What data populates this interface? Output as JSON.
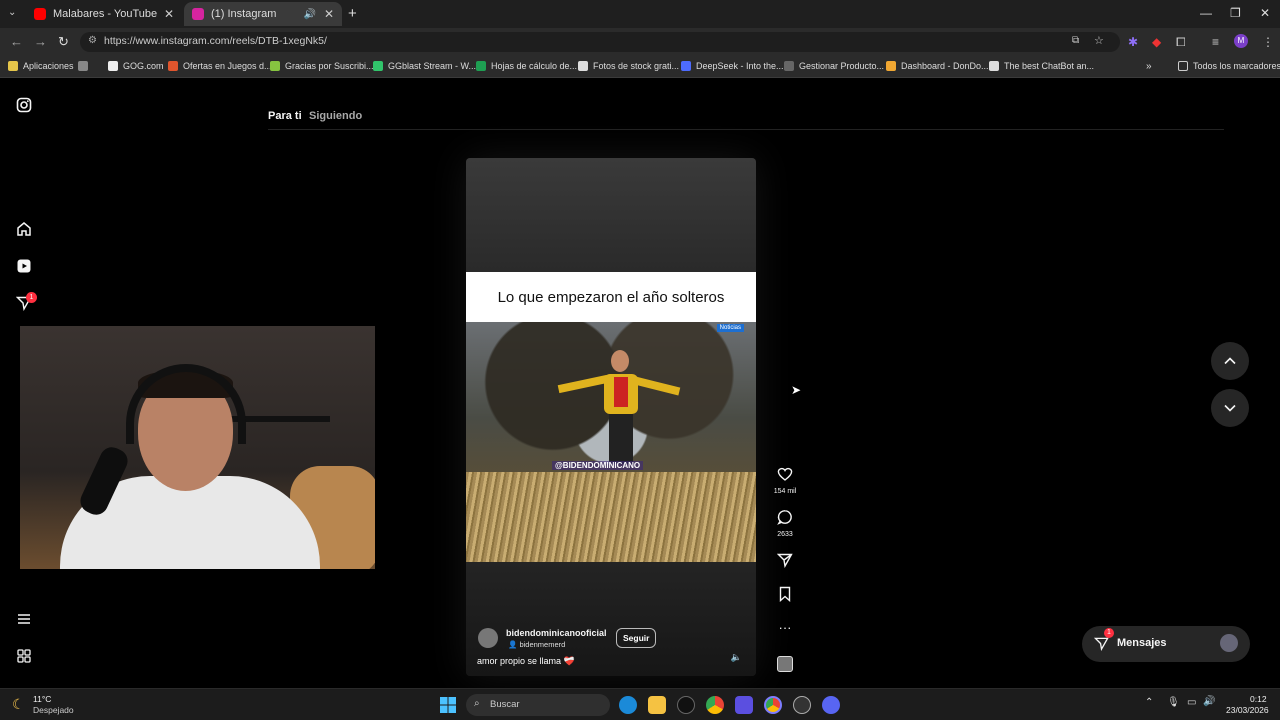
{
  "browser": {
    "tabs": [
      {
        "title": "Malabares - YouTube",
        "favicon": "youtube-icon",
        "color": "#ff0000"
      },
      {
        "title": "(1) Instagram",
        "favicon": "instagram-icon",
        "color": "#d6249f"
      }
    ],
    "url": "https://www.instagram.com/reels/DTB-1xegNk5/",
    "bookmarks": [
      "Aplicaciones",
      "GOG.com",
      "Ofertas en Juegos d...",
      "Gracias por Suscribi...",
      "GGblast Stream - W...",
      "Hojas de cálculo de...",
      "Fotos de stock grati...",
      "DeepSeek - Into the...",
      "Gestionar Producto...",
      "Dashboard - DonDo...",
      "The best ChatBot an..."
    ],
    "all_bookmarks": "Todos los marcadores",
    "profile_initial": "M"
  },
  "instagram": {
    "feed_tabs": [
      "Para ti",
      "Siguiendo"
    ],
    "notifications_badge": "1",
    "reel": {
      "caption_banner": "Lo que empezaron el año solteros",
      "watermark": "@BIDENDOMINICANO",
      "news_tag": "Noticias",
      "username": "bidendominicanooficial",
      "audio": "bidenmemerd",
      "follow_label": "Seguir",
      "description": "amor propio se llama ❤️‍🩹"
    },
    "actions": {
      "likes": "154 mil",
      "comments": "2633"
    },
    "messages": {
      "label": "Mensajes",
      "badge": "1"
    }
  },
  "taskbar": {
    "weather_temp": "11°C",
    "weather_desc": "Despejado",
    "search_label": "Buscar",
    "time": "0:12",
    "date": "23/03/2026"
  }
}
